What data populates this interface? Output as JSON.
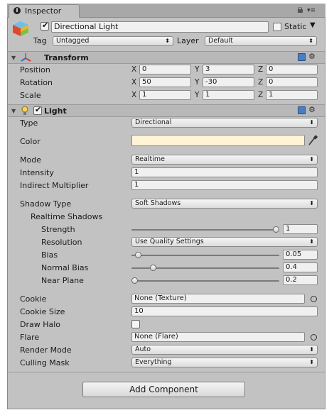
{
  "window": {
    "tab_title": "Inspector"
  },
  "object": {
    "name": "Directional Light",
    "active": true,
    "static_label": "Static",
    "static_checked": false,
    "tag_label": "Tag",
    "tag_value": "Untagged",
    "layer_label": "Layer",
    "layer_value": "Default"
  },
  "transform": {
    "title": "Transform",
    "position_label": "Position",
    "rotation_label": "Rotation",
    "scale_label": "Scale",
    "axes": {
      "x": "X",
      "y": "Y",
      "z": "Z"
    },
    "position": {
      "x": "0",
      "y": "3",
      "z": "0"
    },
    "rotation": {
      "x": "50",
      "y": "-30",
      "z": "0"
    },
    "scale": {
      "x": "1",
      "y": "1",
      "z": "1"
    }
  },
  "light": {
    "title": "Light",
    "enabled": true,
    "type_label": "Type",
    "type_value": "Directional",
    "color_label": "Color",
    "color_value": "#fff4d6",
    "mode_label": "Mode",
    "mode_value": "Realtime",
    "intensity_label": "Intensity",
    "intensity_value": "1",
    "indirect_label": "Indirect Multiplier",
    "indirect_value": "1",
    "shadow_type_label": "Shadow Type",
    "shadow_type_value": "Soft Shadows",
    "realtime_shadows_label": "Realtime Shadows",
    "strength_label": "Strength",
    "strength_value": "1",
    "strength_fraction": 1.0,
    "resolution_label": "Resolution",
    "resolution_value": "Use Quality Settings",
    "bias_label": "Bias",
    "bias_value": "0.05",
    "bias_fraction": 0.025,
    "normal_bias_label": "Normal Bias",
    "normal_bias_value": "0.4",
    "normal_bias_fraction": 0.13,
    "near_plane_label": "Near Plane",
    "near_plane_value": "0.2",
    "near_plane_fraction": 0.0,
    "cookie_label": "Cookie",
    "cookie_value": "None (Texture)",
    "cookie_size_label": "Cookie Size",
    "cookie_size_value": "10",
    "draw_halo_label": "Draw Halo",
    "draw_halo_checked": false,
    "flare_label": "Flare",
    "flare_value": "None (Flare)",
    "render_mode_label": "Render Mode",
    "render_mode_value": "Auto",
    "culling_mask_label": "Culling Mask",
    "culling_mask_value": "Everything"
  },
  "add_component_label": "Add Component",
  "icons": {
    "tab": "info-icon",
    "lock": "lock-icon",
    "menu": "menu-icon",
    "object": "cube-icon",
    "transform": "transform-axes-icon",
    "light": "light-bulb-icon",
    "help": "help-book-icon",
    "settings": "gear-icon",
    "eyedropper": "eyedropper-icon",
    "picker": "object-picker-icon"
  }
}
